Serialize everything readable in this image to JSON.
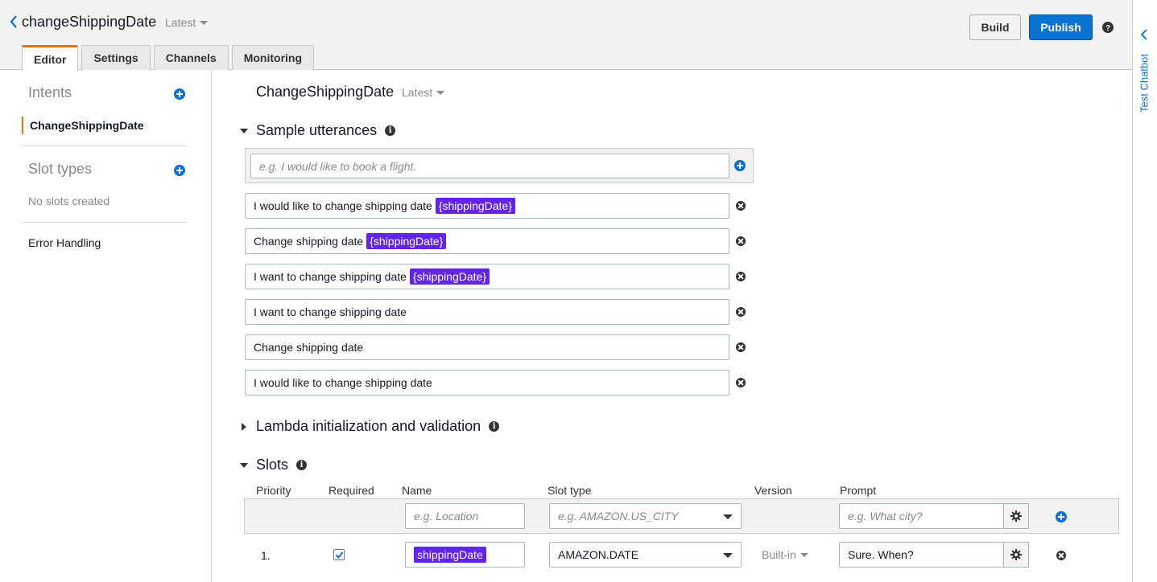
{
  "header": {
    "bot_name": "changeShippingDate",
    "version": "Latest",
    "build_label": "Build",
    "publish_label": "Publish"
  },
  "tabs": [
    {
      "label": "Editor",
      "active": true
    },
    {
      "label": "Settings",
      "active": false
    },
    {
      "label": "Channels",
      "active": false
    },
    {
      "label": "Monitoring",
      "active": false
    }
  ],
  "rail": {
    "label": "Test Chatbot"
  },
  "sidebar": {
    "intents_title": "Intents",
    "active_intent": "ChangeShippingDate",
    "slot_types_title": "Slot types",
    "no_slots": "No slots created",
    "error_handling": "Error Handling"
  },
  "intent": {
    "name": "ChangeShippingDate",
    "version": "Latest"
  },
  "utterances": {
    "title": "Sample utterances",
    "placeholder": "e.g. I would like to book a flight.",
    "items": [
      {
        "text": "I would like to change shipping date",
        "slot": "{shippingDate}"
      },
      {
        "text": "Change shipping date",
        "slot": "{shippingDate}"
      },
      {
        "text": "I want to change shipping date",
        "slot": "{shippingDate}"
      },
      {
        "text": "I want to change shipping date",
        "slot": ""
      },
      {
        "text": "Change shipping date",
        "slot": ""
      },
      {
        "text": "I would like to change shipping date",
        "slot": ""
      }
    ]
  },
  "lambda": {
    "title": "Lambda initialization and validation"
  },
  "slots": {
    "title": "Slots",
    "columns": {
      "priority": "Priority",
      "required": "Required",
      "name": "Name",
      "slot_type": "Slot type",
      "version": "Version",
      "prompt": "Prompt"
    },
    "new_row": {
      "name_placeholder": "e.g. Location",
      "type_placeholder": "e.g. AMAZON.US_CITY",
      "prompt_placeholder": "e.g. What city?"
    },
    "rows": [
      {
        "priority": "1.",
        "required": true,
        "name": "shippingDate",
        "slot_type": "AMAZON.DATE",
        "version": "Built-in",
        "prompt": "Sure. When?"
      }
    ]
  },
  "colors": {
    "accent_orange": "#ec7211",
    "primary_blue": "#0972d3",
    "slot_chip": "#6124ed"
  }
}
